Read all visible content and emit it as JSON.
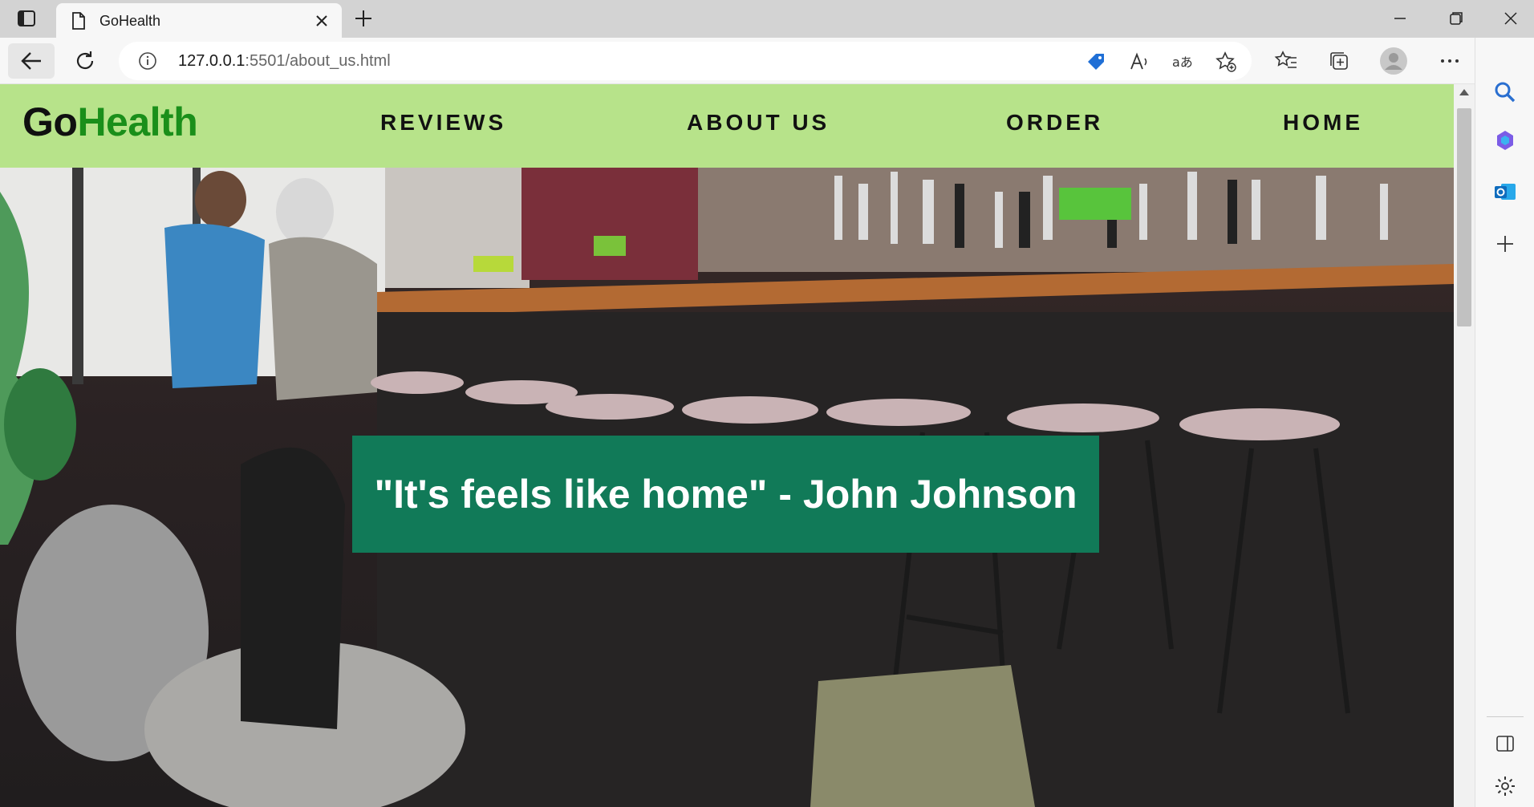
{
  "browser": {
    "tab_title": "GoHealth",
    "url_host": "127.0.0.1",
    "url_rest": ":5501/about_us.html"
  },
  "site": {
    "logo_part1": "Go",
    "logo_part2": "Health",
    "nav": [
      "REVIEWS",
      "ABOUT US",
      "ORDER",
      "HOME"
    ]
  },
  "hero": {
    "quote": "\"It's feels like home\" - John Johnson"
  },
  "colors": {
    "nav_bg": "#b7e38a",
    "logo_health": "#1a8f1a",
    "quote_bg": "#117a58"
  }
}
